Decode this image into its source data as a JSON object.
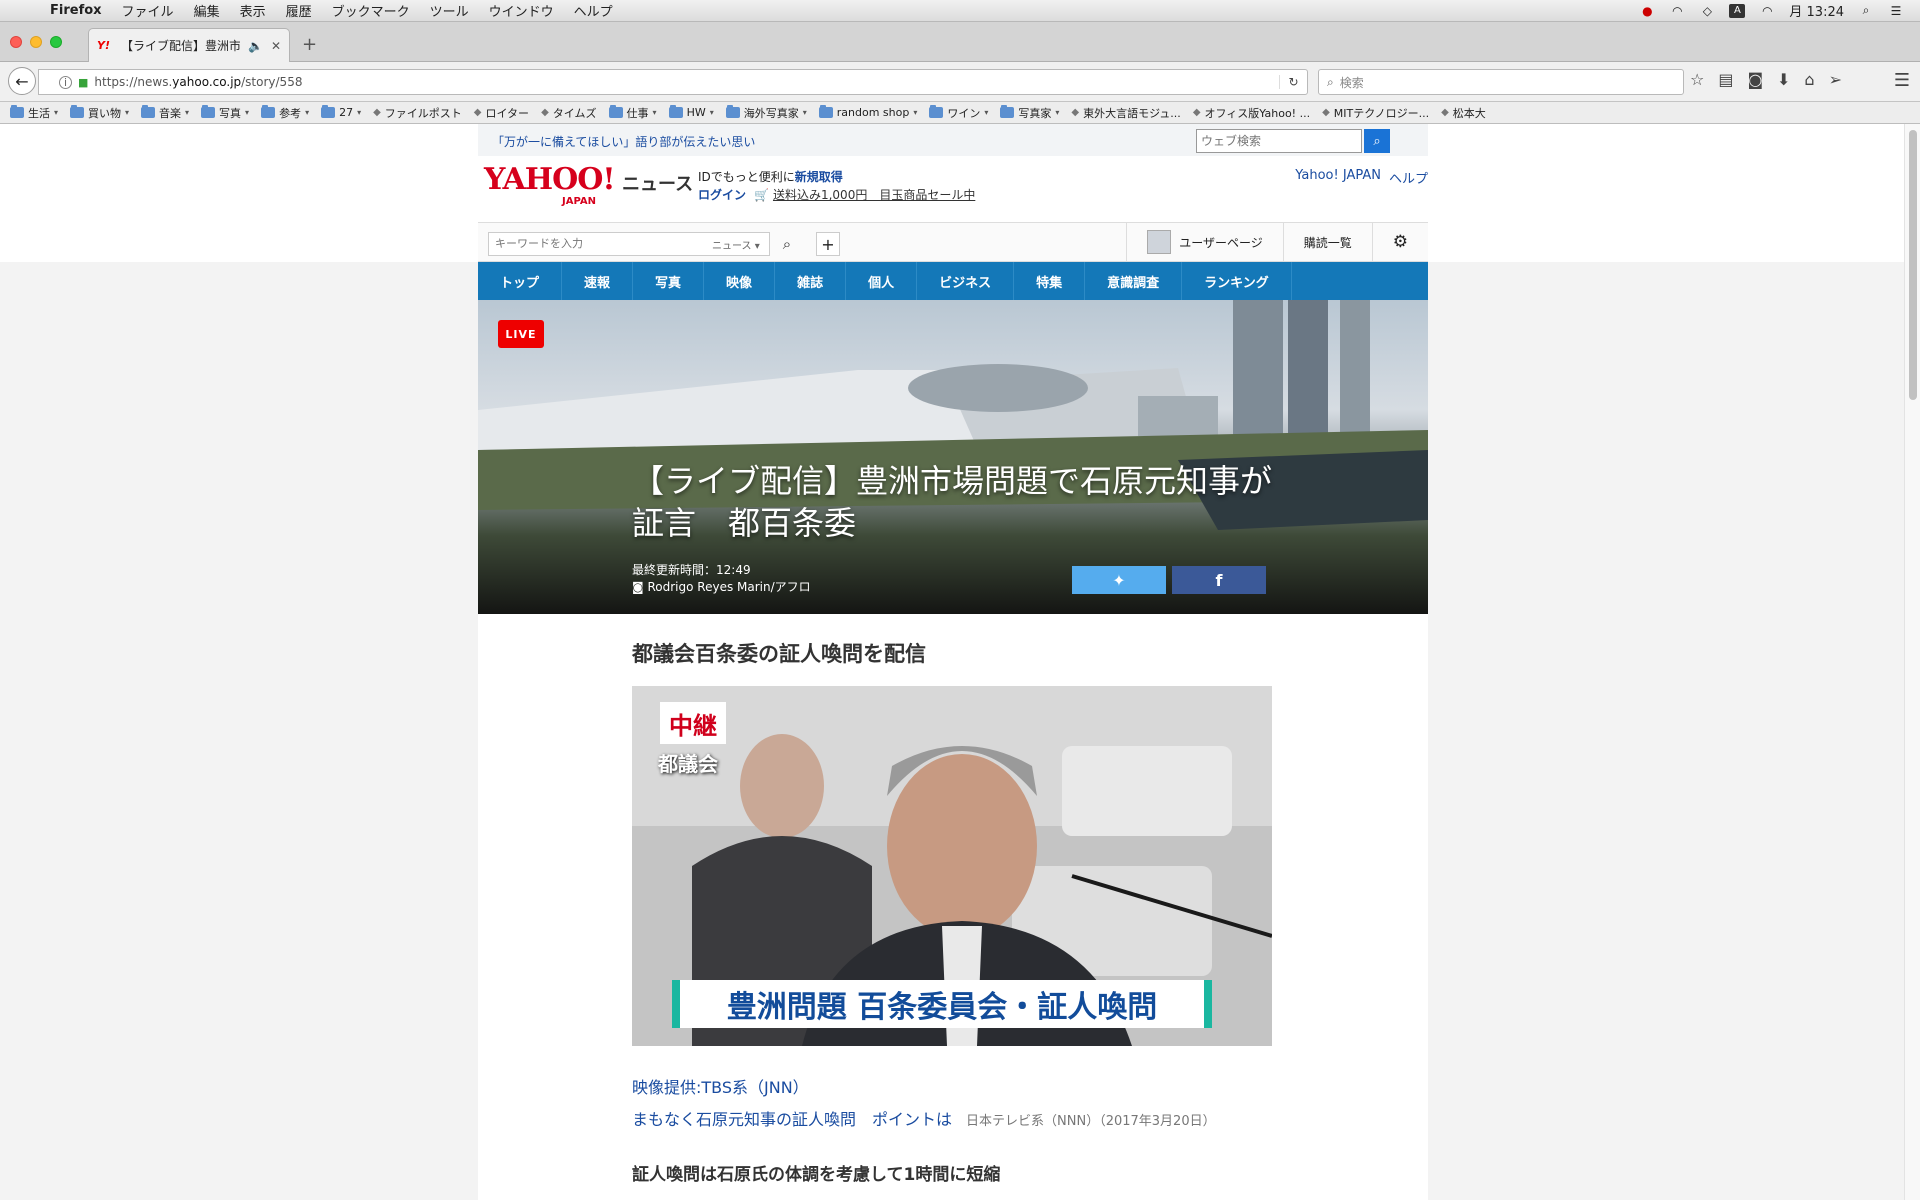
{
  "menubar": {
    "app": "Firefox",
    "items": [
      "ファイル",
      "編集",
      "表示",
      "履歴",
      "ブックマーク",
      "ツール",
      "ウインドウ",
      "ヘルプ"
    ],
    "clock": "月 13:24"
  },
  "tab": {
    "title": "【ライブ配信】豊洲市…",
    "favicon": "Y!"
  },
  "nav": {
    "url_prefix": "https://news.",
    "url_host": "yahoo.co.jp",
    "url_path": "/story/558",
    "search_placeholder": "検索"
  },
  "bookmarks": [
    {
      "label": "生活",
      "type": "folder"
    },
    {
      "label": "買い物",
      "type": "folder"
    },
    {
      "label": "音楽",
      "type": "folder"
    },
    {
      "label": "写真",
      "type": "folder"
    },
    {
      "label": "参考",
      "type": "folder"
    },
    {
      "label": "27",
      "type": "folder"
    },
    {
      "label": "ファイルポスト",
      "type": "link"
    },
    {
      "label": "ロイター",
      "type": "link"
    },
    {
      "label": "タイムズ",
      "type": "link"
    },
    {
      "label": "仕事",
      "type": "folder"
    },
    {
      "label": "HW",
      "type": "folder"
    },
    {
      "label": "海外写真家",
      "type": "folder"
    },
    {
      "label": "random shop",
      "type": "folder"
    },
    {
      "label": "ワイン",
      "type": "folder"
    },
    {
      "label": "写真家",
      "type": "folder"
    },
    {
      "label": "東外大言語モジュ...",
      "type": "link"
    },
    {
      "label": "オフィス版Yahoo! ...",
      "type": "link"
    },
    {
      "label": "MITテクノロジー...",
      "type": "link"
    },
    {
      "label": "松本大",
      "type": "link"
    }
  ],
  "site": {
    "headline": "「万が一に備えてほしい」語り部が伝えたい思い",
    "websearch_placeholder": "ウェブ検索",
    "logo": "YAHOO!",
    "logo_sub": "JAPAN",
    "section": "ニュース",
    "promo_line1": "IDでもっと便利に",
    "promo_signup": "新規取得",
    "promo_login": "ログイン",
    "promo_sale": "送料込み1,000円　目玉商品セール中",
    "top_links": [
      "Yahoo! JAPAN",
      "ヘルプ"
    ],
    "keyword_placeholder": "キーワードを入力",
    "keyword_scope": "ニュース",
    "user_page": "ユーザーページ",
    "subscriptions": "購読一覧"
  },
  "nav_tabs": [
    "トップ",
    "速報",
    "写真",
    "映像",
    "雑誌",
    "個人",
    "ビジネス",
    "特集",
    "意識調査",
    "ランキング"
  ],
  "hero": {
    "live": "LIVE",
    "title": "【ライブ配信】豊洲市場問題で石原元知事が証言　都百条委",
    "updated": "最終更新時間：12:49",
    "photo_credit": "Rodrigo Reyes Marin/アフロ"
  },
  "article": {
    "heading": "都議会百条委の証人喚問を配信",
    "video_badge": "中継",
    "video_badge_sub": "都議会",
    "video_ticker": "豊洲問題  百条委員会・証人喚問",
    "video_credit": "映像提供:TBS系（JNN）",
    "related_link": "まもなく石原元知事の証人喚問　ポイントは",
    "related_source": "日本テレビ系（NNN）（2017年3月20日）",
    "subhead": "証人喚問は石原氏の体調を考慮して1時間に短縮"
  },
  "colors": {
    "brand_red": "#d6001c",
    "nav_blue": "#1478b8",
    "link_blue": "#1a4ca0",
    "twitter": "#55acee",
    "facebook": "#3b5998",
    "live_red": "#e00000"
  }
}
